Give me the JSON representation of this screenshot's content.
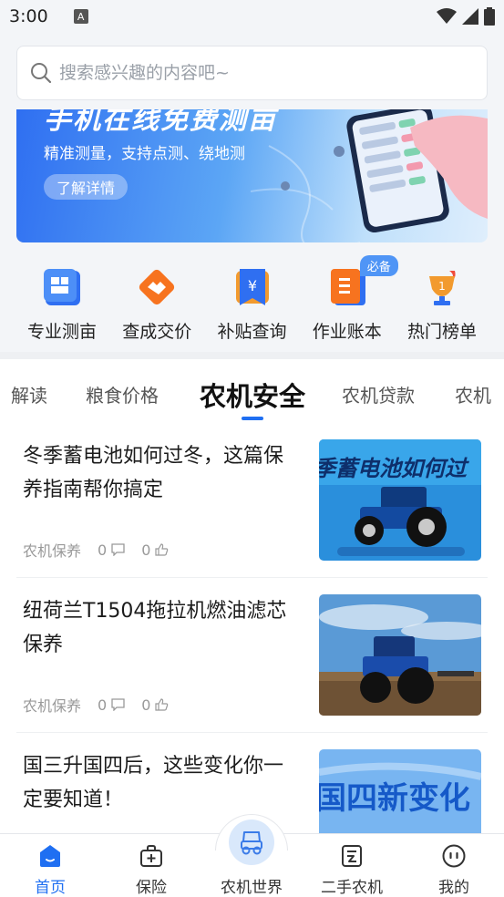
{
  "status": {
    "time": "3:00",
    "notif_glyph": "A"
  },
  "search": {
    "placeholder": "搜索感兴趣的内容吧~"
  },
  "banner": {
    "headline": "手机在线免费测亩",
    "subtitle": "精准测量，支持点测、绕地测",
    "button": "了解详情"
  },
  "quick_links": [
    {
      "label": "专业测亩",
      "icon": "field-measure-icon"
    },
    {
      "label": "查成交价",
      "icon": "handshake-icon"
    },
    {
      "label": "补贴查询",
      "icon": "yuan-bookmark-icon"
    },
    {
      "label": "作业账本",
      "icon": "ledger-book-icon",
      "badge": "必备"
    },
    {
      "label": "热门榜单",
      "icon": "trophy-icon"
    }
  ],
  "tabs": [
    {
      "label": "解读"
    },
    {
      "label": "粮食价格"
    },
    {
      "label": "农机安全",
      "active": true
    },
    {
      "label": "农机贷款"
    },
    {
      "label": "农机"
    }
  ],
  "articles": [
    {
      "title": "冬季蓄电池如何过冬，这篇保养指南帮你搞定",
      "category": "农机保养",
      "comments": "0",
      "likes": "0",
      "thumb_text": "季蓄电池如何过"
    },
    {
      "title": "纽荷兰T1504拖拉机燃油滤芯保养",
      "category": "农机保养",
      "comments": "0",
      "likes": "0",
      "thumb_text": ""
    },
    {
      "title": "国三升国四后，这些变化你一定要知道！",
      "category": "",
      "comments": "",
      "likes": "",
      "thumb_text": "国四新变化"
    }
  ],
  "bottom_nav": [
    {
      "label": "首页",
      "icon": "home-icon",
      "active": true
    },
    {
      "label": "保险",
      "icon": "insurance-bag-icon"
    },
    {
      "label": "农机世界",
      "icon": "tractor-icon"
    },
    {
      "label": "二手农机",
      "icon": "secondhand-doc-icon"
    },
    {
      "label": "我的",
      "icon": "profile-face-icon"
    }
  ],
  "colors": {
    "accent": "#1f6ff2",
    "badge": "#4f95f6"
  }
}
